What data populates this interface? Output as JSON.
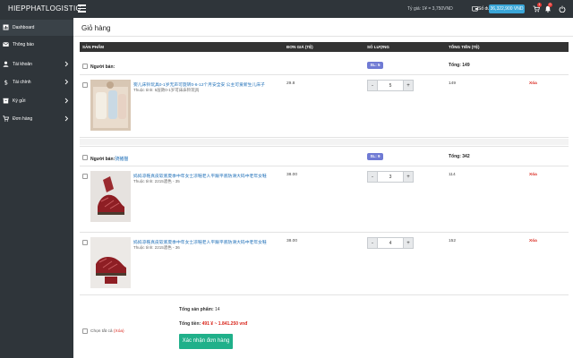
{
  "header": {
    "brand": "HIEPPHATLOGISTIC",
    "rate_text": "Tỷ giá: 1¥ = 3,750VND",
    "balance_label": "Số dư:",
    "balance_value": "36,322,900 VND",
    "cart_badge": "1",
    "bell_badge": "0"
  },
  "sidebar": {
    "items": [
      {
        "label": "Dashboard",
        "icon": "dashboard-icon"
      },
      {
        "label": "Thông báo",
        "icon": "envelope-icon"
      },
      {
        "label": "Tài khoản",
        "icon": "user-icon"
      },
      {
        "label": "Tài chính",
        "icon": "dollar-icon"
      },
      {
        "label": "Ký gửi",
        "icon": "box-icon"
      },
      {
        "label": "Đơn hàng",
        "icon": "cart-icon"
      }
    ]
  },
  "page": {
    "title": "Giỏ hàng"
  },
  "table": {
    "headers": [
      "SẢN PHẨM",
      "ĐƠN GIÁ (TỆ)",
      "SỐ LƯỢNG",
      "TỔNG TIỀN (TỆ)"
    ]
  },
  "sellers": [
    {
      "name": "Người bán:",
      "sl": "SL: 5",
      "total": "Tổng: 149",
      "items": [
        {
          "name": "婴儿床铃玩具0-1岁无声可旋转0-6-12个月安全安 公主可爱新生儿床子",
          "attr": "Thuộc tính: 5层款0-1岁可床床铃玩具",
          "price": "29.8",
          "qty": "5",
          "subtotal": "149",
          "delete": "Xóa"
        }
      ]
    },
    {
      "name": "Người bán:",
      "name_link": "骑猪猫",
      "sl": "SL: 9",
      "total": "Tổng: 342",
      "items": [
        {
          "name": "妈妈凉鞋真皮软底夏季中年女士凉鞋老人平跟平底防滑大码中老年女鞋",
          "attr": "Thuộc tính: 2215酒色 - 35",
          "price": "38.00",
          "qty": "3",
          "subtotal": "114",
          "delete": "Xóa"
        },
        {
          "name": "妈妈凉鞋真皮软底夏季中年女士凉鞋老人平跟平底防滑大码中老年女鞋",
          "attr": "Thuộc tính: 2215酒色 - 36",
          "price": "38.00",
          "qty": "4",
          "subtotal": "152",
          "delete": "Xóa"
        }
      ]
    }
  ],
  "summary": {
    "select_all": "Chọn tất cả",
    "select_all_delete": "(Xóa)",
    "total_products_label": "Tổng sản phẩm:",
    "total_products_value": "14",
    "total_money_label": "Tổng tiền:",
    "total_money_value": "491 ¥ ~ 1.841.250 vnđ",
    "confirm_button": "Xác nhận đơn hàng"
  },
  "colors": {
    "sidebar": "#2f353a",
    "balance": "#3aa6d8",
    "sl_badge": "#6f7ad4",
    "delete": "#d9261c",
    "confirm": "#20b08a"
  }
}
